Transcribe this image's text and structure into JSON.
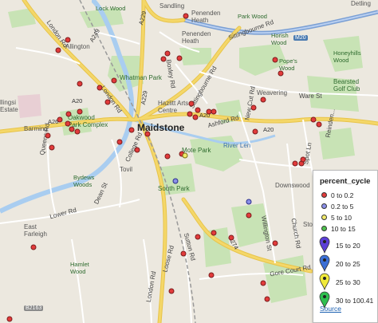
{
  "map": {
    "places": {
      "maidstone": "Maidstone",
      "allington": "Allington",
      "barming": "Barming",
      "tovil": "Tovil",
      "penenden_heath": "Penenden\nHeath",
      "sandling": "Sandling",
      "lock_wood": "Lock Wood",
      "park_wood": "Park Wood",
      "detling": "Detling",
      "horish_wood": "Horish\nWood",
      "popes_wood": "Pope's\nWood",
      "honeyhills_wood": "Honeyhills\nWood",
      "bearsted_golf": "Bearsted\nGolf Club",
      "weavering": "Weavering",
      "downswood": "Downswood",
      "east_farleigh": "East\nFarleigh",
      "hamlet_wood": "Hamlet\nWood",
      "bydews_woods": "Bydews\nWoods",
      "mote_park": "Mote Park",
      "south_park": "South Park",
      "whatman_park": "Whatman Park",
      "oakwood": "Oakwood\nPark Complex",
      "hazlitt": "Hazlitt Arts\nCentre",
      "penenden_heath2": "Penenden\nHeath",
      "ollings_estate": "llingsi\nEstate",
      "river_len": "River Len",
      "sto": "Sto"
    },
    "roads": {
      "a229_1": "A229",
      "a229_2": "A229",
      "a20_1": "A20",
      "a20_2": "A20",
      "a20_3": "A20",
      "a26": "A26",
      "a274": "A274",
      "a249": "A249",
      "m20": "M20",
      "london_rd": "London Rd",
      "london_rd2": "London Rd",
      "boxley_rd": "Boxley Rd",
      "sittingbourne_rd": "Sittingbourne Rd",
      "sittingbourne_rd2": "Sittingbourne Rd",
      "new_cut_rd": "New Cut Rd",
      "ashford_rd": "Ashford Rd",
      "ware_st": "Ware St",
      "spot_ln": "Spot Ln",
      "queens_rd": "Queens Rd",
      "college_rd": "College Rd",
      "dean_st": "Dean St",
      "lower_rd": "Lower Rd",
      "willington_st": "Willington St",
      "church_rd": "Church Rd",
      "loose_rd": "Loose Rd",
      "sutton_rd": "Sutton Rd",
      "gore_court_rd": "Gore Court Rd",
      "b2163": "B2163",
      "reinden": "Reinden..."
    }
  },
  "legend": {
    "title": "percent_cycle",
    "items": [
      {
        "label": "0 to 0.2",
        "color": "#e23b3b",
        "kind": "dot"
      },
      {
        "label": "0.2 to 5",
        "color": "#8a8fe8",
        "kind": "dot"
      },
      {
        "label": "5 to 10",
        "color": "#f1ea6a",
        "kind": "dot"
      },
      {
        "label": "10 to 15",
        "color": "#4fc24f",
        "kind": "dot"
      },
      {
        "label": "15 to 20",
        "color": "#5b3fd6",
        "kind": "pin"
      },
      {
        "label": "20 to 25",
        "color": "#3b6fd6",
        "kind": "pin"
      },
      {
        "label": "25 to 30",
        "color": "#f0ea3a",
        "kind": "pin"
      },
      {
        "label": "30 to 100.41",
        "color": "#2fbf4f",
        "kind": "pin"
      }
    ],
    "source_label": "Source"
  },
  "colors": {
    "land": "#ece8df",
    "water": "#a9cdf0",
    "park": "#c8e3b5",
    "urban": "#e3e0d9",
    "motorway": "#7a9fd4",
    "a_road": "#f4d769",
    "minor_road": "#ffffff",
    "marker_red": "#e23b3b",
    "marker_blue": "#8a8fe8",
    "marker_yellow": "#f1ea6a"
  }
}
